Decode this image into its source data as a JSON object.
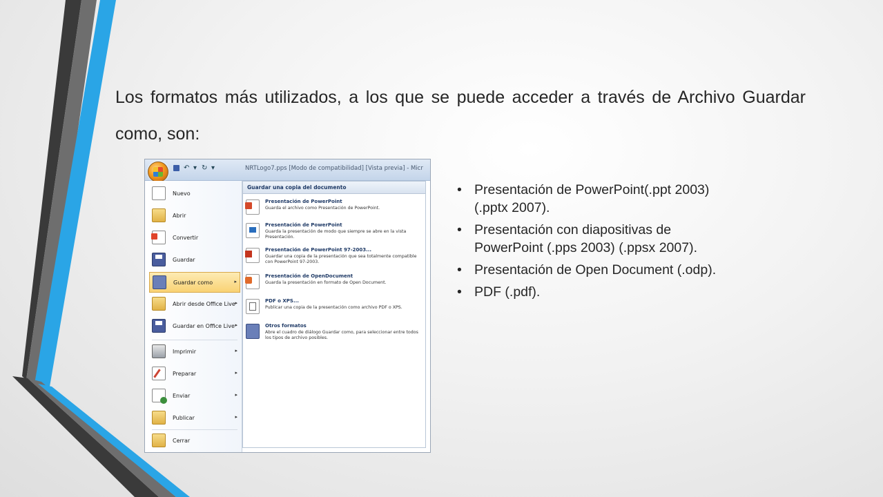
{
  "slide": {
    "title": "Los formatos más utilizados, a los que se puede acceder a través de Archivo Guardar como, son:",
    "bullets": [
      {
        "line1": "Presentación de PowerPoint(.ppt 2003)",
        "line2": "(.pptx 2007)."
      },
      {
        "line1": "Presentación con diapositivas de",
        "line2": "PowerPoint (.pps 2003) (.ppsx 2007)."
      },
      {
        "line1": "Presentación de Open Document (.odp).",
        "line2": ""
      },
      {
        "line1": "PDF (.pdf).",
        "line2": ""
      }
    ]
  },
  "screenshot": {
    "window_title": "NRTLogo7.pps [Modo de compatibilidad] [Vista previa] - Micr",
    "quick_access": {
      "undo": "↶",
      "redo": "↻",
      "more": "▾"
    },
    "left_menu": [
      {
        "label": "Nuevo",
        "icon": "new-document-icon",
        "arrow": ""
      },
      {
        "label": "Abrir",
        "icon": "open-folder-icon",
        "arrow": ""
      },
      {
        "label": "Convertir",
        "icon": "convert-icon",
        "arrow": ""
      },
      {
        "label": "Guardar",
        "icon": "save-disk-icon",
        "arrow": ""
      },
      {
        "label": "Guardar como",
        "icon": "save-as-icon",
        "arrow": "▸"
      },
      {
        "label": "Abrir desde Office Live",
        "icon": "open-live-icon",
        "arrow": "▸"
      },
      {
        "label": "Guardar en Office Live",
        "icon": "save-live-icon",
        "arrow": "▸"
      },
      {
        "label": "Imprimir",
        "icon": "printer-icon",
        "arrow": "▸"
      },
      {
        "label": "Preparar",
        "icon": "prepare-icon",
        "arrow": "▸"
      },
      {
        "label": "Enviar",
        "icon": "send-icon",
        "arrow": "▸"
      },
      {
        "label": "Publicar",
        "icon": "publish-icon",
        "arrow": "▸"
      },
      {
        "label": "Cerrar",
        "icon": "close-folder-icon",
        "arrow": ""
      }
    ],
    "right_pane": {
      "header": "Guardar una copia del documento",
      "options": [
        {
          "title": "Presentación de PowerPoint",
          "desc": "Guarda el archivo como Presentación de PowerPoint."
        },
        {
          "title": "Presentación de PowerPoint",
          "desc": "Guarda la presentación de modo que siempre se abre en la vista Presentación."
        },
        {
          "title": "Presentación de PowerPoint 97-2003...",
          "desc": "Guardar una copia de la presentación que sea totalmente compatible con PowerPoint 97-2003."
        },
        {
          "title": "Presentación de OpenDocument",
          "desc": "Guarda la presentación en formato de Open Document."
        },
        {
          "title": "PDF o XPS...",
          "desc": "Publicar una copia de la presentación como archivo PDF o XPS."
        },
        {
          "title": "Otros formatos",
          "desc": "Abre el cuadro de diálogo Guardar como, para seleccionar entre todos los tipos de archivo posibles."
        }
      ]
    }
  },
  "colors": {
    "accent_blue": "#2aa5e6",
    "dark_stripe": "#3a3a3a",
    "gray_stripe": "#6e6e6e",
    "text": "#262626"
  }
}
